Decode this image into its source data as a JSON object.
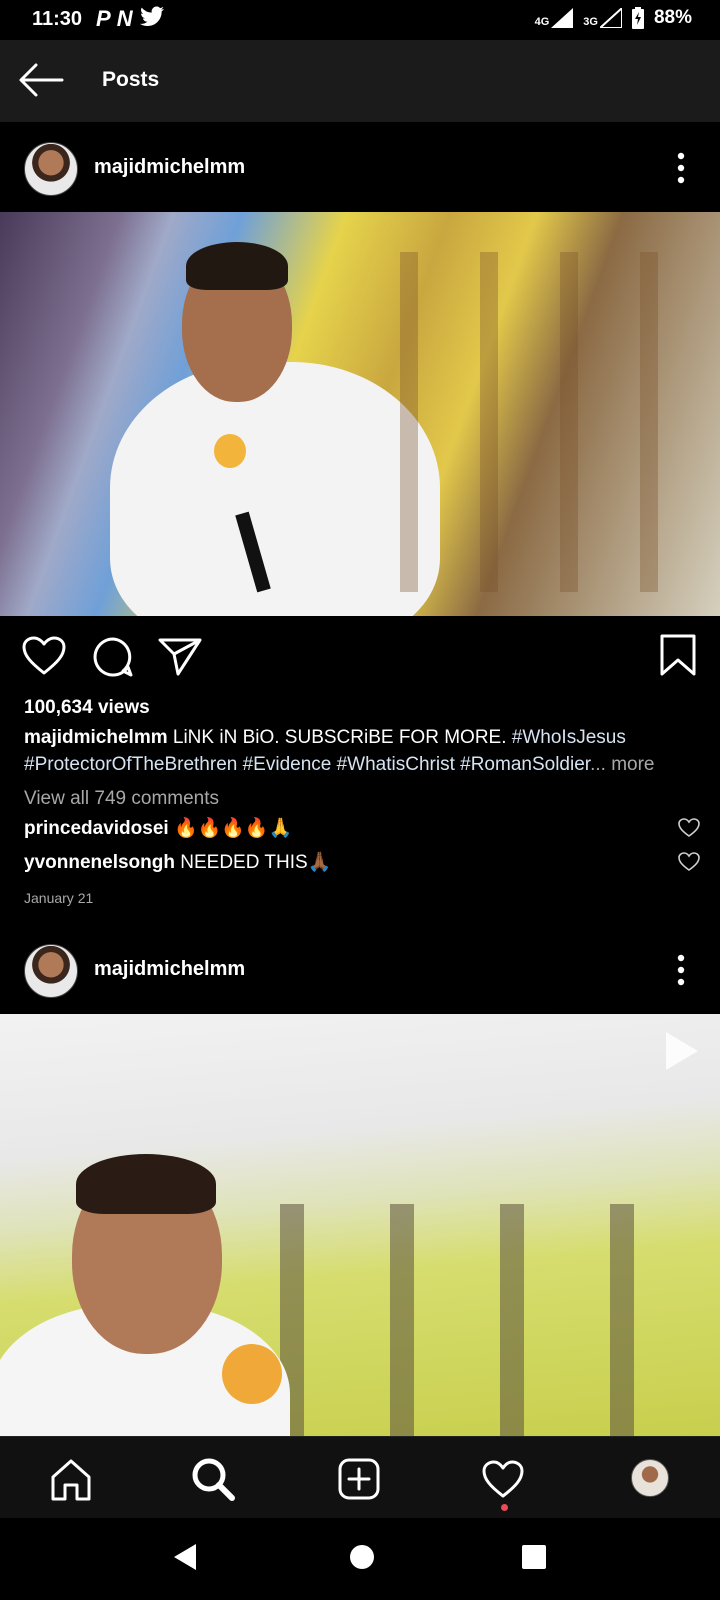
{
  "status_bar": {
    "time": "11:30",
    "notification_icons": [
      "P",
      "N",
      "twitter-icon"
    ],
    "network_1": "4G",
    "network_2": "3G",
    "battery": "88%"
  },
  "topbar": {
    "title": "Posts"
  },
  "posts": [
    {
      "username": "majidmichelmm",
      "views": "100,634 views",
      "caption_user": "majidmichelmm",
      "caption_text": "LiNK iN BiO. SUBSCRiBE FOR MORE.",
      "hashtag_1": "#WhoIsJesus",
      "hashtags_line2": "#ProtectorOfTheBrethren #Evidence #WhatisChrist #RomanSoldier",
      "ellipsis": "...",
      "more": "more",
      "view_comments": "View all 749 comments",
      "comments": [
        {
          "user": "princedavidosei",
          "text": "🔥🔥🔥🔥🙏"
        },
        {
          "user": "yvonnenelsongh",
          "text": "NEEDED THIS🙏🏾"
        }
      ],
      "date": "January 21"
    },
    {
      "username": "majidmichelmm"
    }
  ],
  "colors": {
    "background": "#000000",
    "topbar": "#1b1b1b",
    "notification_dot": "#ed4956",
    "hashtag": "#d6e3f2"
  }
}
